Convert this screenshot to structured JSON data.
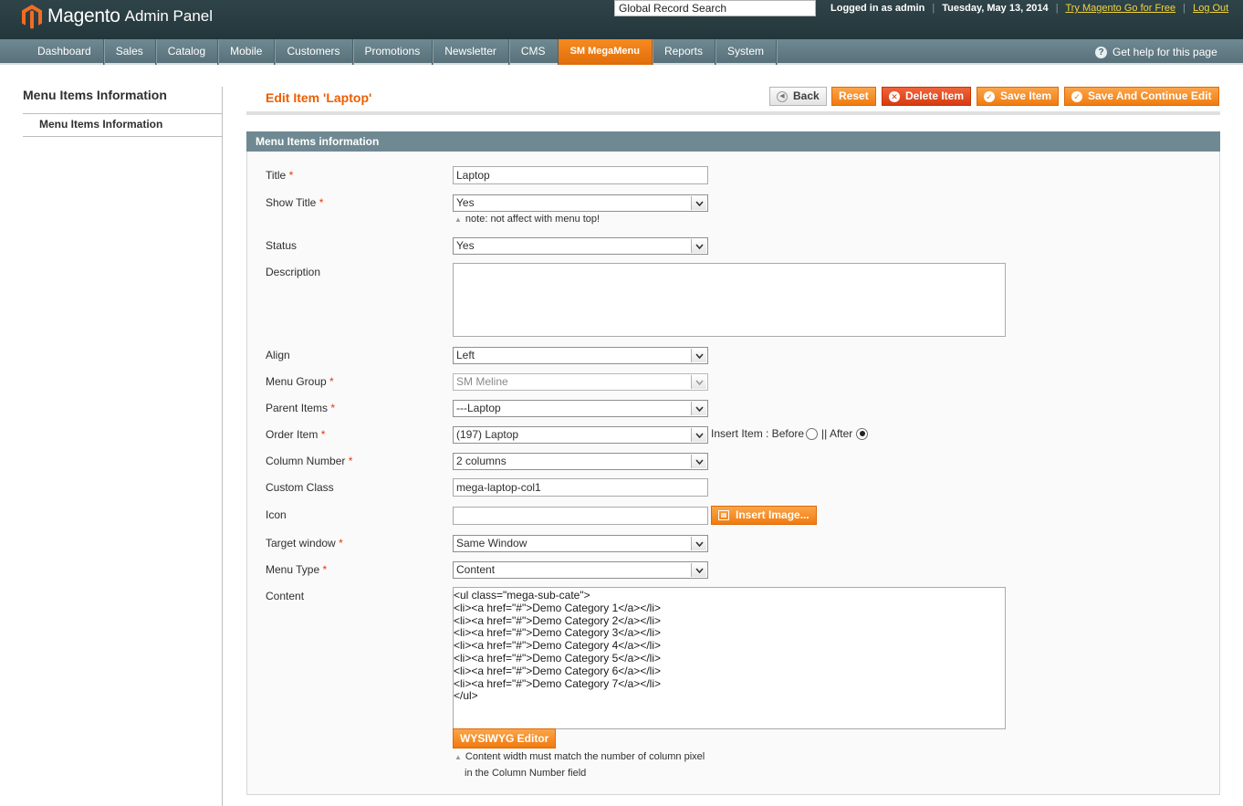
{
  "header": {
    "logo_text": "Magento",
    "logo_sub": "Admin Panel",
    "search_value": "Global Record Search",
    "logged_in": "Logged in as admin",
    "date": "Tuesday, May 13, 2014",
    "try_link": "Try Magento Go for Free",
    "logout_link": "Log Out"
  },
  "nav": {
    "items": [
      "Dashboard",
      "Sales",
      "Catalog",
      "Mobile",
      "Customers",
      "Promotions",
      "Newsletter",
      "CMS",
      "SM MegaMenu",
      "Reports",
      "System"
    ],
    "active": "SM MegaMenu",
    "help": "Get help for this page"
  },
  "sidebar": {
    "title": "Menu Items Information",
    "item": "Menu Items Information"
  },
  "page": {
    "title": "Edit Item 'Laptop'",
    "buttons": {
      "back": "Back",
      "reset": "Reset",
      "delete": "Delete Item",
      "save": "Save Item",
      "save_continue": "Save And Continue Edit"
    }
  },
  "form": {
    "section_title": "Menu Items information",
    "required_mark": "*",
    "title_label": "Title",
    "title_value": "Laptop",
    "show_title_label": "Show Title",
    "show_title_value": "Yes",
    "show_title_note": "note: not affect with menu top!",
    "status_label": "Status",
    "status_value": "Yes",
    "description_label": "Description",
    "align_label": "Align",
    "align_value": "Left",
    "menu_group_label": "Menu Group",
    "menu_group_value": "SM Meline",
    "parent_label": "Parent Items",
    "parent_value": "---Laptop",
    "order_label": "Order Item",
    "order_value": "(197) Laptop",
    "insert_item_label": "Insert Item : Before",
    "insert_after_label": "|| After",
    "column_label": "Column Number",
    "column_value": "2 columns",
    "custom_class_label": "Custom Class",
    "custom_class_value": "mega-laptop-col1",
    "icon_label": "Icon",
    "insert_image": "Insert Image...",
    "target_label": "Target window",
    "target_value": "Same Window",
    "menu_type_label": "Menu Type",
    "menu_type_value": "Content",
    "content_label": "Content",
    "content_value": "<ul class=\"mega-sub-cate\">\n<li><a href=\"#\">Demo Category 1</a></li>\n<li><a href=\"#\">Demo Category 2</a></li>\n<li><a href=\"#\">Demo Category 3</a></li>\n<li><a href=\"#\">Demo Category 4</a></li>\n<li><a href=\"#\">Demo Category 5</a></li>\n<li><a href=\"#\">Demo Category 6</a></li>\n<li><a href=\"#\">Demo Category 7</a></li>\n</ul>",
    "wysiwyg": "WYSIWYG Editor",
    "content_note_1": "Content width must match the number of column pixel",
    "content_note_2": "in the Column Number field"
  }
}
